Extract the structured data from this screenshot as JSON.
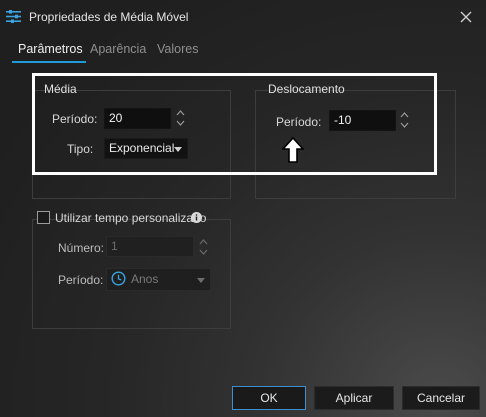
{
  "window": {
    "title": "Propriedades de Média Móvel",
    "icon": "sliders-icon",
    "close_icon": "close-icon"
  },
  "tabs": [
    {
      "label": "Parâmetros",
      "active": true
    },
    {
      "label": "Aparência",
      "active": false
    },
    {
      "label": "Valores",
      "active": false
    }
  ],
  "media": {
    "title": "Média",
    "periodo_label": "Período:",
    "periodo_value": "20",
    "tipo_label": "Tipo:",
    "tipo_value": "Exponencial"
  },
  "deslocamento": {
    "title": "Deslocamento",
    "periodo_label": "Período:",
    "periodo_value": "-10"
  },
  "custom_time": {
    "checkbox_label": "Utilizar tempo personalizado",
    "checked": false,
    "numero_label": "Número:",
    "numero_value": "1",
    "periodo_label": "Período:",
    "periodo_value": "Anos"
  },
  "buttons": {
    "ok": "OK",
    "apply": "Aplicar",
    "cancel": "Cancelar"
  },
  "colors": {
    "accent": "#1e9bd7",
    "highlight": "#ffffff"
  }
}
